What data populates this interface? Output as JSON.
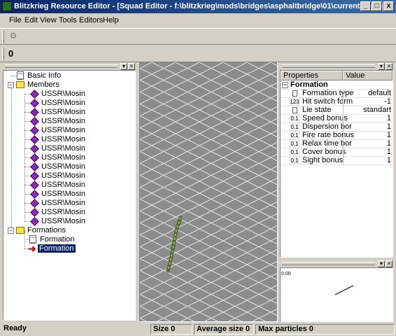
{
  "window": {
    "title": "Blitzkrieg Resource Editor - [Squad Editor - f:\\blitzkrieg\\mods\\bridges\\asphaltbridge\\01\\current.scp *]",
    "buttons": [
      "_",
      "□",
      "x"
    ]
  },
  "menu": [
    "File",
    "Edit",
    "View",
    "Tools",
    "Editors",
    "Help"
  ],
  "toolbar": {
    "counter": "0"
  },
  "tree": {
    "basic_info": "Basic Info",
    "members_label": "Members",
    "members": [
      "USSR\\Mosin",
      "USSR\\Mosin",
      "USSR\\Mosin",
      "USSR\\Mosin",
      "USSR\\Mosin",
      "USSR\\Mosin",
      "USSR\\Mosin",
      "USSR\\Mosin",
      "USSR\\Mosin",
      "USSR\\Mosin",
      "USSR\\Mosin",
      "USSR\\Mosin",
      "USSR\\Mosin",
      "USSR\\Mosin",
      "USSR\\Mosin"
    ],
    "formations_label": "Formations",
    "formation_item": "Formation",
    "formation_selected": "Formation"
  },
  "properties": {
    "headers": [
      "Properties",
      "Value"
    ],
    "group": "Formation",
    "rows": [
      {
        "icon": "doc",
        "name": "Formation type",
        "value": "default"
      },
      {
        "icon": "123",
        "name": "Hit switch form",
        "value": "-1"
      },
      {
        "icon": "doc",
        "name": "Lie state",
        "value": "standart"
      },
      {
        "icon": "0.1",
        "name": "Speed bonus",
        "value": "1"
      },
      {
        "icon": "0.1",
        "name": "Dispersion bor",
        "value": "1"
      },
      {
        "icon": "0.1",
        "name": "Fire rate bonus",
        "value": "1"
      },
      {
        "icon": "0.1",
        "name": "Relax time bor",
        "value": "1"
      },
      {
        "icon": "0.1",
        "name": "Cover bonus",
        "value": "1"
      },
      {
        "icon": "0.1",
        "name": "Sight bonus",
        "value": "1"
      }
    ]
  },
  "mini_graph": {
    "label": "0.00"
  },
  "status": {
    "ready": "Ready",
    "size": "Size 0",
    "avg": "Average size 0",
    "max": "Max particles 0"
  },
  "colors": {
    "title_bar": "#0a246a",
    "selection": "#0a246a",
    "viewport_bg": "#8c8c8c"
  }
}
